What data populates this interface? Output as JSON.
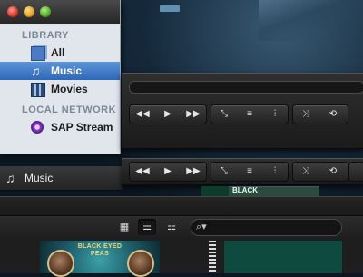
{
  "sidebar": {
    "sections": [
      {
        "title": "LIBRARY",
        "items": [
          {
            "label": "All",
            "icon": "stack-icon"
          },
          {
            "label": "Music",
            "icon": "music-note-icon",
            "selected": true
          },
          {
            "label": "Movies",
            "icon": "film-icon"
          }
        ]
      },
      {
        "title": "LOCAL NETWORK",
        "items": [
          {
            "label": "SAP Stream",
            "icon": "stream-icon"
          }
        ]
      }
    ]
  },
  "player": {
    "buttons": [
      "rewind-icon",
      "play-icon",
      "fast-forward-icon",
      "fullscreen-icon",
      "playlist-icon",
      "equalizer-icon",
      "shuffle-icon",
      "repeat-icon"
    ],
    "glyphs": {
      "rewind": "◀◀",
      "play": "▶",
      "forward": "▶▶",
      "fullscreen": "⤡",
      "playlist": "≡",
      "equalizer": "⫶",
      "shuffle": "⤨",
      "repeat": "⟲"
    }
  },
  "music_pane": {
    "title": "Music",
    "view_glyphs": {
      "grid": "▦",
      "list": "☰",
      "detail": "☷"
    },
    "search": {
      "glyph": "⌕▾",
      "placeholder": ""
    }
  },
  "covers": {
    "peek_title": "BLACK",
    "main_cover_title": "BLACK EYED PEAS"
  },
  "colors": {
    "selection": "#3a7ad0",
    "sidebar_bg": "#e1e6ed",
    "player_bg": "#242424"
  }
}
